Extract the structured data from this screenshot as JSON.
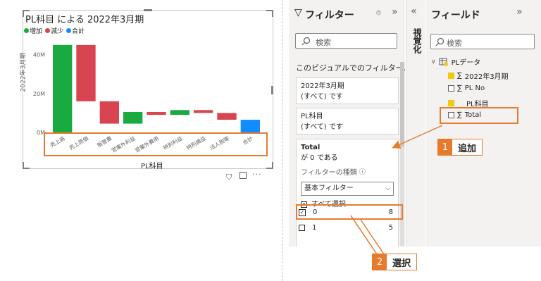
{
  "chart": {
    "title": "PL科目 による 2022年3月期",
    "legend": [
      {
        "label": "増加",
        "color": "#1aab40"
      },
      {
        "label": "減少",
        "color": "#d64550"
      },
      {
        "label": "合計",
        "color": "#118dff"
      }
    ],
    "xlabel": "PL科目",
    "ylabel": "2022年3月期"
  },
  "chart_data": {
    "type": "bar",
    "subtype": "waterfall",
    "categories": [
      "売上高",
      "売上原価",
      "販管費",
      "営業外利益",
      "営業外費用",
      "特別利益",
      "特別損益",
      "法人税等",
      "合計"
    ],
    "steps": [
      {
        "kind": "increase",
        "start": 0,
        "end": 45
      },
      {
        "kind": "decrease",
        "start": 45,
        "end": 16
      },
      {
        "kind": "decrease",
        "start": 16,
        "end": 4.5
      },
      {
        "kind": "increase",
        "start": 4.5,
        "end": 10.5
      },
      {
        "kind": "decrease",
        "start": 10.5,
        "end": 9
      },
      {
        "kind": "increase",
        "start": 9,
        "end": 11.5
      },
      {
        "kind": "decrease",
        "start": 11.5,
        "end": 10
      },
      {
        "kind": "decrease",
        "start": 10,
        "end": 6.5
      },
      {
        "kind": "total",
        "start": 0,
        "end": 6.5
      }
    ],
    "yticks": [
      "0M",
      "20M",
      "40M"
    ],
    "ytick_values": [
      0,
      20,
      40
    ],
    "ylim": [
      0,
      50
    ],
    "grid": false,
    "legend_position": "top-left"
  },
  "filter_pane": {
    "title": "フィルター",
    "search_placeholder": "検索",
    "section": "このビジュアルでのフィルター...",
    "cards": [
      {
        "field": "2022年3月期",
        "value": "(すべて) です"
      },
      {
        "field": "PL科目",
        "value": "(すべて) です"
      }
    ],
    "total_card": {
      "field": "Total",
      "condition": "が 0 である",
      "filter_type_label": "フィルターの種類",
      "filter_type_value": "基本フィルター",
      "select_all": "すべて選択",
      "options": [
        {
          "label": "0",
          "count": "8",
          "checked": true
        },
        {
          "label": "1",
          "count": "5",
          "checked": false
        }
      ]
    }
  },
  "viz_strip": {
    "label": "視覚化"
  },
  "fields_pane": {
    "title": "フィールド",
    "search_placeholder": "検索",
    "table": "PLデータ",
    "fields": [
      {
        "label": "2022年3月期",
        "sigma": true,
        "checked": true
      },
      {
        "label": "PL No",
        "sigma": true,
        "checked": false
      },
      {
        "label": "PL科目",
        "sigma": false,
        "checked": true
      },
      {
        "label": "Total",
        "sigma": true,
        "checked": false
      }
    ]
  },
  "callouts": [
    {
      "num": "1",
      "text": "追加"
    },
    {
      "num": "2",
      "text": "選択"
    }
  ]
}
